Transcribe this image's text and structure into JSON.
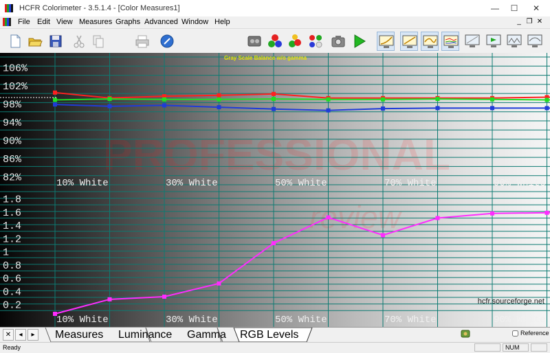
{
  "window": {
    "title": "HCFR Colorimeter - 3.5.1.4 - [Color Measures1]",
    "minimize_glyph": "—",
    "maximize_glyph": "☐",
    "close_glyph": "✕"
  },
  "menu": {
    "items": [
      "File",
      "Edit",
      "View",
      "Measures",
      "Graphs",
      "Advanced",
      "Window",
      "Help"
    ],
    "mdi_glyphs": [
      "_",
      "❐",
      "✕"
    ]
  },
  "toolbar": {
    "buttons": [
      "new-file",
      "open-folder",
      "save-disk",
      "cut-scissors",
      "copy",
      "print",
      "about",
      "generator",
      "rgb-balls",
      "sensor-select",
      "pattern-colors",
      "camera",
      "play-measure",
      "graph-gamma",
      "graph-luminance",
      "graph-curve",
      "graph-rgb-levels",
      "monitor-a",
      "monitor-b",
      "monitor-c",
      "monitor-d",
      "monitor-e"
    ]
  },
  "colors": {
    "red": "#ff2020",
    "green": "#22dd22",
    "blue": "#1f3cd8",
    "magenta": "#ff2cff",
    "grid": "#0d7a72",
    "title_yellow": "#e6e600"
  },
  "graph": {
    "title": "Gray Scale Balance w/o gamma",
    "top_y_labels": [
      "106%",
      "102%",
      "98%",
      "94%",
      "90%",
      "86%",
      "82%"
    ],
    "bottom_y_labels": [
      "1.8",
      "1.6",
      "1.4",
      "1.2",
      "1",
      "0.8",
      "0.6",
      "0.4",
      "0.2"
    ],
    "x_labels": [
      "10% White",
      "30% White",
      "50% White",
      "70% White",
      "90% White"
    ],
    "watermark": "hcfr.sourceforge.net",
    "big_watermark": "PROFESSIONAL",
    "big_watermark_sub": "review"
  },
  "chart_data": [
    {
      "type": "line",
      "title": "Gray Scale Balance w/o gamma",
      "x": [
        "0%",
        "10%",
        "20%",
        "30%",
        "40%",
        "50%",
        "60%",
        "70%",
        "80%",
        "90%",
        "100%"
      ],
      "ylim": [
        80,
        108
      ],
      "series": [
        {
          "color": "#ff2020",
          "values": [
            100.2,
            99.0,
            99.4,
            99.6,
            99.9,
            99.0,
            99.0,
            99.0,
            99.0,
            99.2,
            99.0
          ]
        },
        {
          "color": "#22dd22",
          "values": [
            98.6,
            98.8,
            98.7,
            98.7,
            98.8,
            98.7,
            98.7,
            98.8,
            98.7,
            98.6,
            98.6
          ]
        },
        {
          "color": "#1f3cd8",
          "values": [
            97.6,
            97.2,
            97.4,
            97.0,
            96.6,
            96.3,
            96.7,
            96.8,
            96.8,
            96.8,
            96.8
          ]
        }
      ]
    },
    {
      "type": "line",
      "title": "",
      "x": [
        "0%",
        "10%",
        "20%",
        "30%",
        "40%",
        "50%",
        "60%",
        "70%",
        "80%",
        "90%",
        "100%"
      ],
      "ylim": [
        0.05,
        1.9
      ],
      "series": [
        {
          "color": "#ff2cff",
          "values": [
            0.05,
            0.27,
            0.31,
            0.51,
            1.12,
            1.51,
            1.24,
            1.5,
            1.57,
            1.58,
            1.59
          ]
        }
      ]
    }
  ],
  "tabs": {
    "nav": [
      "✕",
      "◂",
      "▸"
    ],
    "items": [
      "Measures",
      "Luminance",
      "Gamma",
      "RGB Levels"
    ],
    "active": "RGB Levels"
  },
  "reference_label": "Reference",
  "status": {
    "text": "Ready",
    "num": "NUM"
  }
}
